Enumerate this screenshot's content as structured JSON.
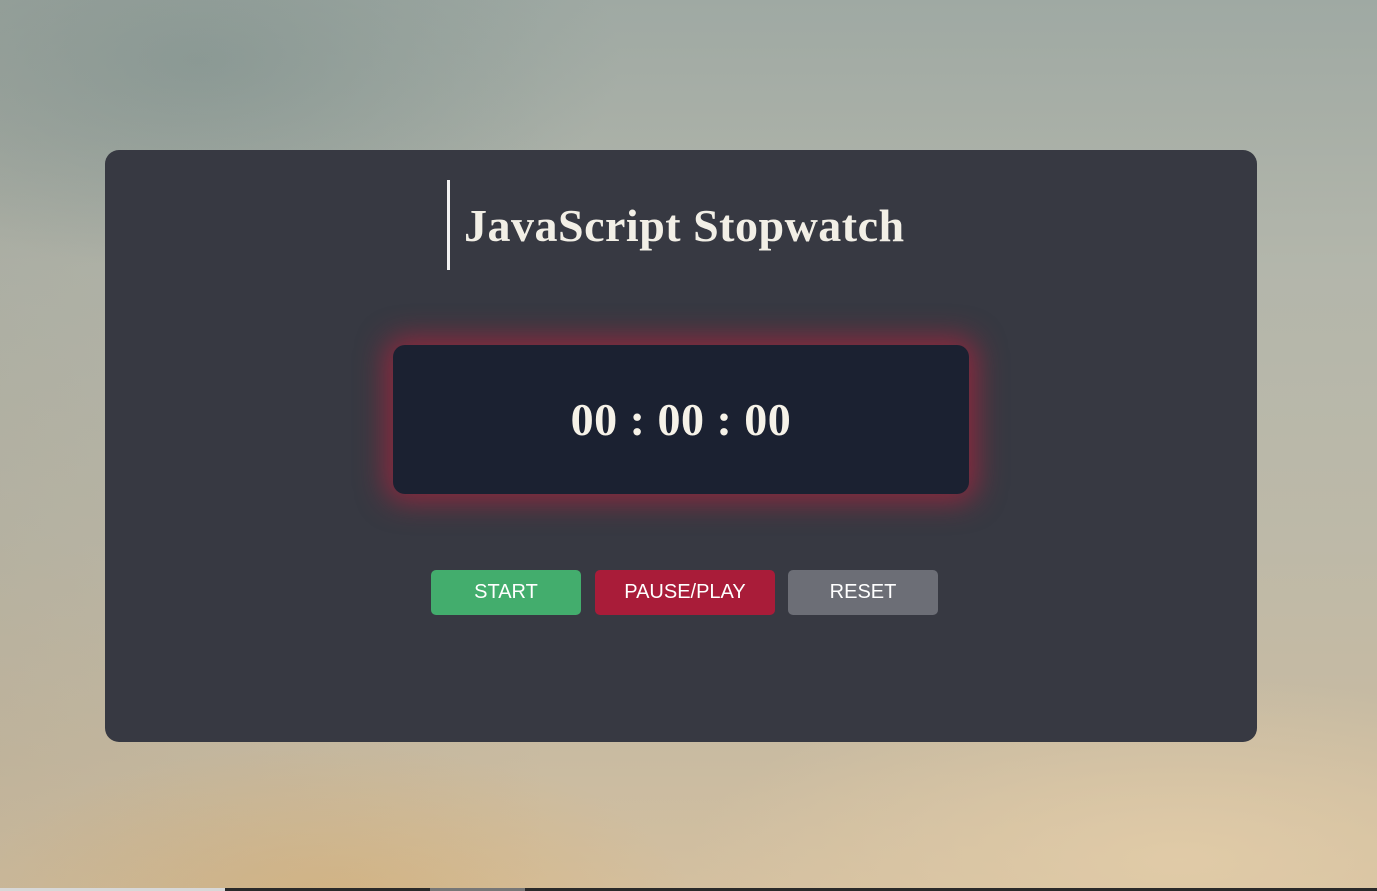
{
  "app": {
    "title": "JavaScript Stopwatch"
  },
  "stopwatch": {
    "hours": "00",
    "minutes": "00",
    "seconds": "00",
    "separator": " : ",
    "display": "00 : 00 : 00"
  },
  "controls": {
    "start_label": "START",
    "pause_label": "PAUSE/PLAY",
    "reset_label": "RESET"
  },
  "colors": {
    "card_background": "#373942",
    "display_background": "#1b2131",
    "display_glow": "#be1e3c",
    "start_button": "#43ad6d",
    "pause_button": "#a91c39",
    "reset_button": "#6c6e76",
    "text": "#f2efe6"
  }
}
